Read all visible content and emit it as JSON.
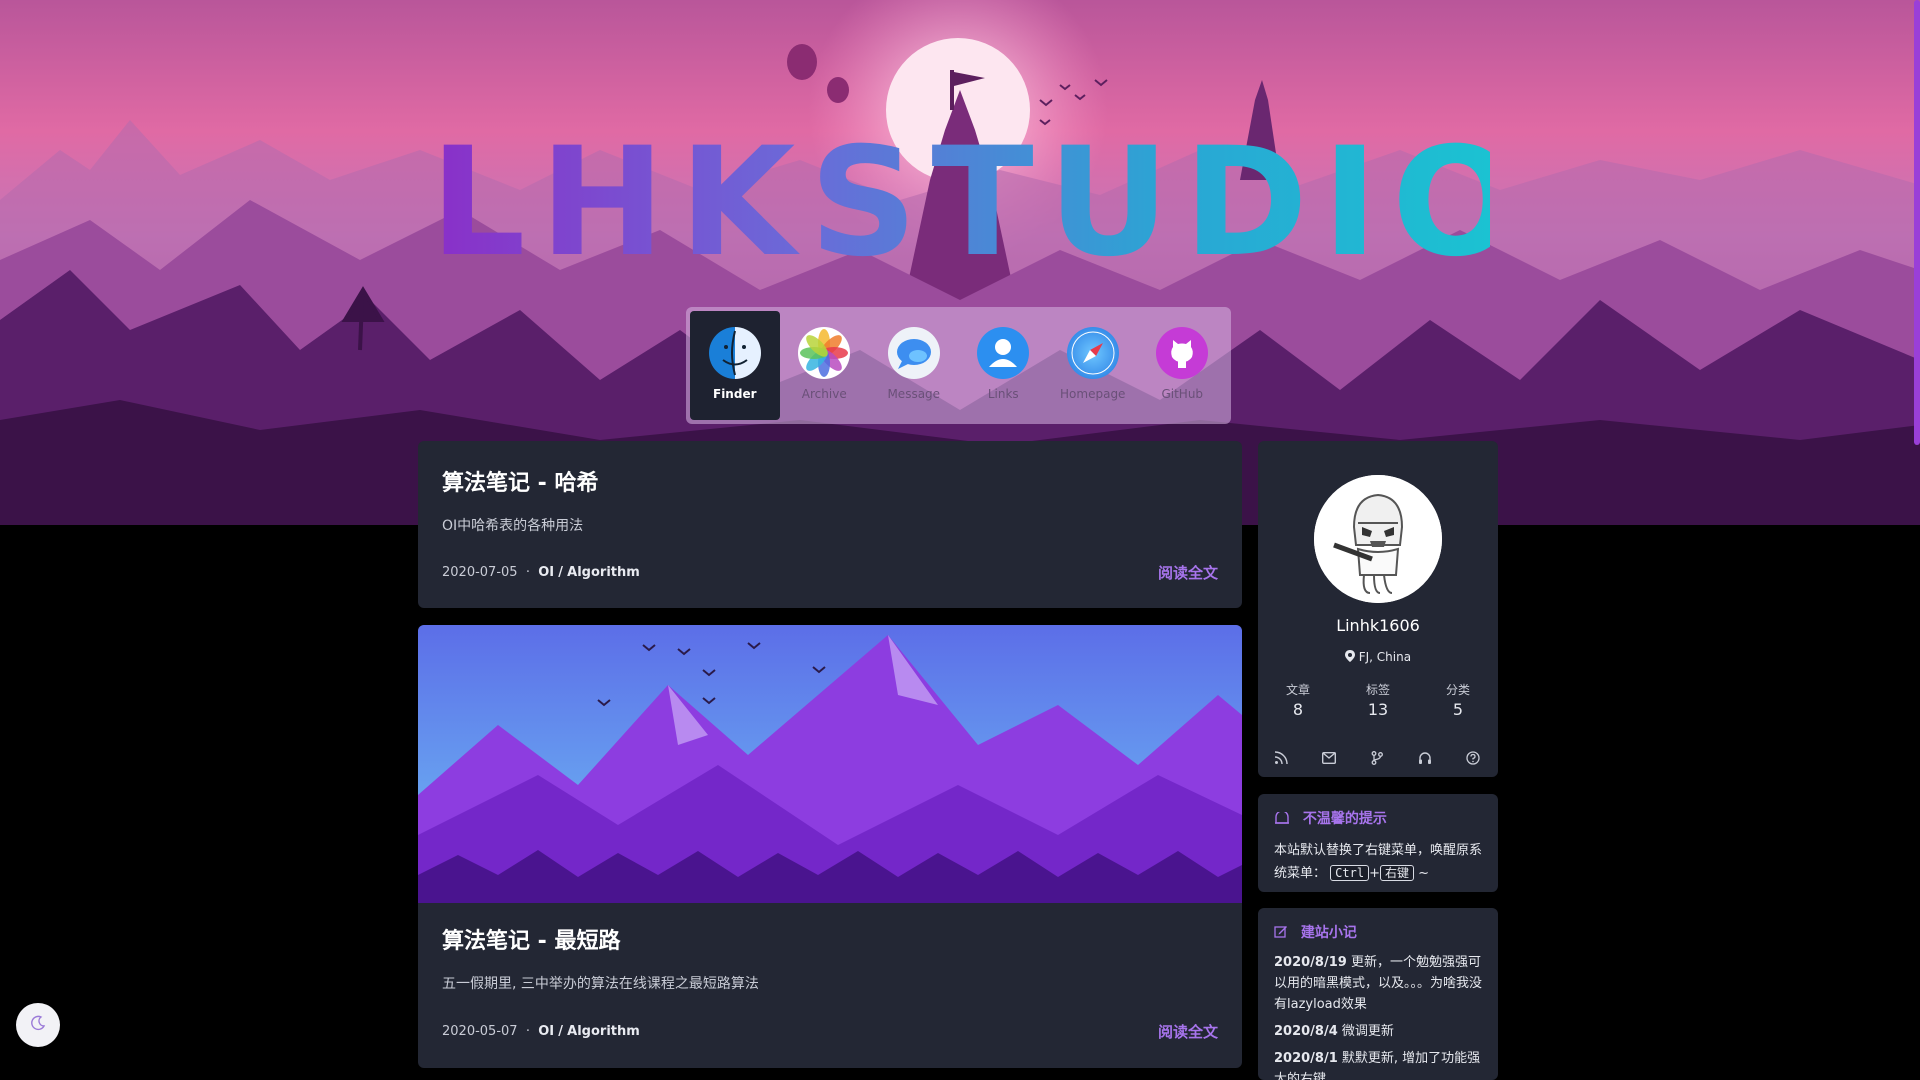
{
  "brand": {
    "logo_text": "LHKSTUDIO"
  },
  "dock": {
    "items": [
      {
        "label": "Finder",
        "icon": "finder-icon",
        "active": true
      },
      {
        "label": "Archive",
        "icon": "photos-icon",
        "active": false
      },
      {
        "label": "Message",
        "icon": "message-icon",
        "active": false
      },
      {
        "label": "Links",
        "icon": "contacts-icon",
        "active": false
      },
      {
        "label": "Homepage",
        "icon": "safari-icon",
        "active": false
      },
      {
        "label": "GitHub",
        "icon": "github-icon",
        "active": false
      }
    ]
  },
  "posts": [
    {
      "title": "算法笔记 - 哈希",
      "excerpt": "OI中哈希表的各种用法",
      "date": "2020-07-05",
      "separator": "·",
      "category": "OI",
      "slash": "/",
      "subcategory": "Algorithm",
      "read_more": "阅读全文",
      "has_cover": false
    },
    {
      "title": "算法笔记 - 最短路",
      "excerpt": "五一假期里, 三中举办的算法在线课程之最短路算法",
      "date": "2020-05-07",
      "separator": "·",
      "category": "OI",
      "slash": "/",
      "subcategory": "Algorithm",
      "read_more": "阅读全文",
      "has_cover": true
    }
  ],
  "profile": {
    "name": "Linhk1606",
    "location": "FJ, China",
    "stats": [
      {
        "label": "文章",
        "value": "8"
      },
      {
        "label": "标签",
        "value": "13"
      },
      {
        "label": "分类",
        "value": "5"
      }
    ],
    "social_icons": [
      "rss-icon",
      "mail-icon",
      "git-branch-icon",
      "headphones-icon",
      "help-icon"
    ]
  },
  "notice": {
    "title": "不温馨的提示",
    "text": "本站默认替换了右键菜单，唤醒原系统菜单：",
    "key1": "Ctrl",
    "plus": "+",
    "key2": "右键",
    "tail": "~"
  },
  "changelog": {
    "title": "建站小记",
    "entries": [
      {
        "date": "2020/8/19",
        "text": "更新，一个勉勉强强可以用的暗黑模式，以及。。。为啥我没有lazyload效果"
      },
      {
        "date": "2020/8/4",
        "text": "微调更新"
      },
      {
        "date": "2020/8/1",
        "text": "默默更新, 增加了功能强大的右键"
      }
    ]
  },
  "colors": {
    "accent": "#a774ec",
    "card": "#232734",
    "page": "#000000"
  }
}
